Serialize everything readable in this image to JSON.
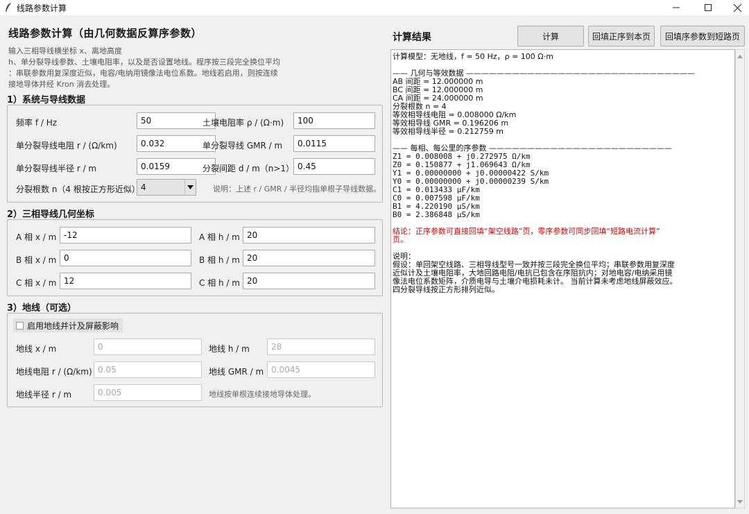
{
  "window": {
    "title": "线路参数计算",
    "icon": "feather-icon",
    "controls": [
      "minimize-icon",
      "maximize-icon",
      "close-icon"
    ]
  },
  "left": {
    "title": "线路参数计算（由几何数据反算序参数）",
    "description": [
      "输入三相导线横坐标 x、离地高度",
      "h、单分裂导线参数、土壤电阻率，以及是否设置地线。程序按三段完全换位平均",
      "：串联参数用复深度近似，电容/电纳用镜像法电位系数。地线若启用，则按连续",
      "接地导体并经 Kron 消去处理。"
    ],
    "section1": {
      "heading": "1）系统与导线数据",
      "freq_label": "频率 f / Hz",
      "freq_value": "50",
      "rho_label": "土壤电阻率 ρ / (Ω·m)",
      "rho_value": "100",
      "r_label": "单分裂导线电阻 r / (Ω/km)",
      "r_value": "0.032",
      "gmr_label": "单分裂导线 GMR / m",
      "gmr_value": "0.0115",
      "radius_label": "单分裂导线半径 r / m",
      "radius_value": "0.0159",
      "spacing_label": "分裂间距 d / m（n>1）",
      "spacing_value": "0.45",
      "n_label": "分裂根数 n（4 根按正方形近似）",
      "n_value": "4",
      "note": "说明：上述 r / GMR / 半径均指单根子导线数据。"
    },
    "section2": {
      "heading": "2）三相导线几何坐标",
      "ax_label": "A 相 x / m",
      "ax_value": "-12",
      "ah_label": "A 相 h / m",
      "ah_value": "20",
      "bx_label": "B 相 x / m",
      "bx_value": "0",
      "bh_label": "B 相 h / m",
      "bh_value": "20",
      "cx_label": "C 相 x / m",
      "cx_value": "12",
      "ch_label": "C 相 h / m",
      "ch_value": "20"
    },
    "section3": {
      "heading": "3）地线（可选）",
      "checkbox_label": "启用地线并计及屏蔽影响",
      "gx_label": "地线 x / m",
      "gx_value": "0",
      "gh_label": "地线 h / m",
      "gh_value": "28",
      "gr_label": "地线电阻 r / (Ω/km)",
      "gr_value": "0.05",
      "ggmr_label": "地线 GMR / m",
      "ggmr_value": "0.0045",
      "grad_label": "地线半径 r / m",
      "grad_value": "0.005",
      "note": "地线按单根连续接地导体处理。"
    }
  },
  "right": {
    "title": "计算结果",
    "buttons": {
      "calc": "计算",
      "fill_positive": "回填正序到本页",
      "fill_short": "回填序参数到短路页"
    },
    "results": [
      "计算模型：无地线，f = 50 Hz，ρ = 100 Ω·m",
      "",
      "—— 几何与等效数据 ——————————————————————————————",
      "AB 间距 = 12.000000 m",
      "BC 间距 = 12.000000 m",
      "CA 间距 = 24.000000 m",
      "分裂根数 n = 4",
      "等效相导线电阻 = 0.008000 Ω/km",
      "等效相导线 GMR = 0.196206 m",
      "等效相导线半径 = 0.212759 m",
      "",
      "—— 每相、每公里的序参数 ————————————————————————",
      "Z1 = 0.008008 + j0.272975 Ω/km",
      "Z0 = 0.150877 + j1.069643 Ω/km",
      "Y1 = 0.00000000 + j0.00000422 S/km",
      "Y0 = 0.00000000 + j0.00000239 S/km",
      "C1 = 0.013433 μF/km",
      "C0 = 0.007598 μF/km",
      "B1 = 4.220190 μS/km",
      "B0 = 2.386848 μS/km"
    ],
    "conclusion": [
      "结论：正序参数可直接回填“架空线路”页，零序参数可同步回填“短路电流计算”",
      "页。"
    ],
    "explanation": [
      "说明：",
      "假设：单回架空线路、三相导线型号一致并按三段完全换位平均；串联参数用复深度",
      "近似计及土壤电阻率，大地回路电阻/电抗已包含在序阻抗内；对地电容/电纳采用镜",
      "像法电位系数矩阵，介质电导与土壤介电损耗未计。 当前计算未考虑地线屏蔽效应。",
      "四分裂导线按正方形排列近似。"
    ]
  }
}
